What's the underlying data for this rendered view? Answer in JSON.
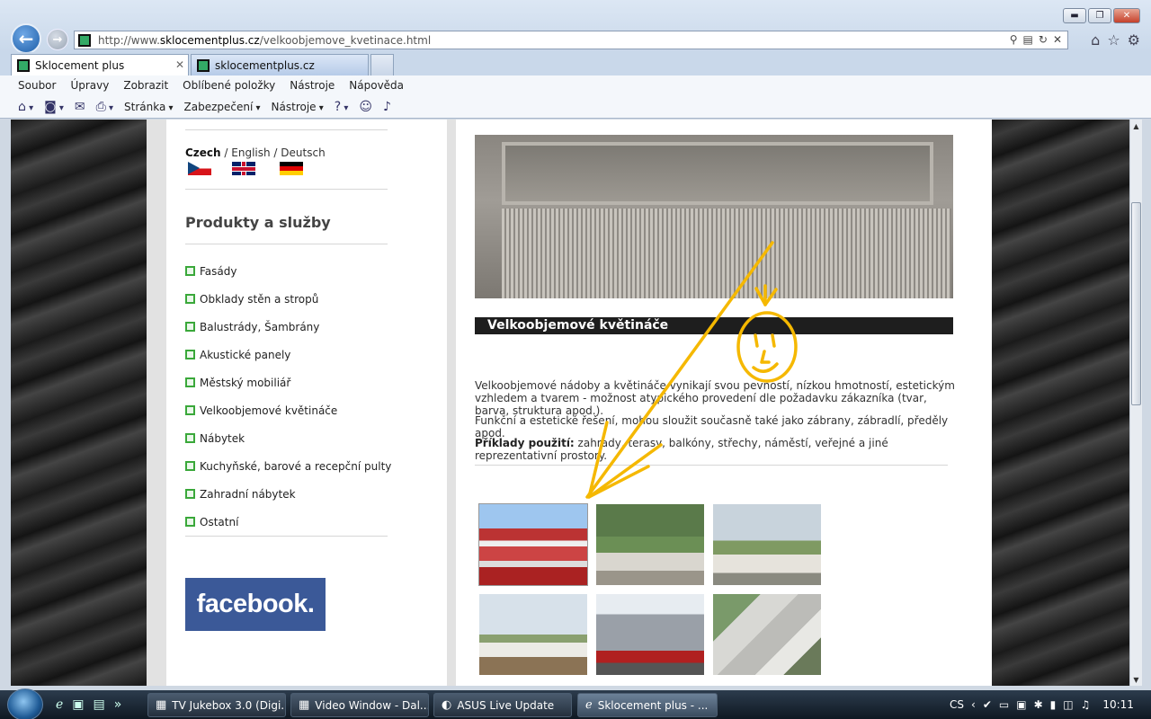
{
  "browser": {
    "url_prefix": "http://www.",
    "url_domain": "sklocementplus.cz",
    "url_path": "/velkoobjemove_kvetinace.html",
    "tabs": [
      {
        "label": "Sklocement plus",
        "close": "✕"
      },
      {
        "label": "sklocementplus.cz"
      }
    ],
    "menu": [
      "Soubor",
      "Úpravy",
      "Zobrazit",
      "Oblíbené položky",
      "Nástroje",
      "Nápověda"
    ],
    "commands": {
      "page": "Stránka",
      "security": "Zabezpečení",
      "tools": "Nástroje"
    },
    "window": {
      "minimize": "▬",
      "restore": "❐",
      "close": "✕"
    }
  },
  "sidebar": {
    "lang_czech": "Czech",
    "lang_english": "English",
    "lang_deutsch": "Deutsch",
    "sep": " / ",
    "products_title": "Produkty a služby",
    "products": [
      "Fasády",
      "Obklady stěn a stropů",
      "Balustrády, Šambrány",
      "Akustické panely",
      "Městský mobiliář",
      "Velkoobjemové květináče",
      "Nábytek",
      "Kuchyňské, barové a recepční pulty",
      "Zahradní nábytek",
      "Ostatní"
    ],
    "facebook": "facebook."
  },
  "main": {
    "section_title": "Velkoobjemové květináče",
    "p1": "Velkoobjemové nádoby a květináče vynikají svou pevností, nízkou hmotností, estetickým vzhledem a tvarem - možnost atypického provedení dle požadavku zákazníka (tvar, barva, struktura apod.).",
    "p2": "Funkční a estetické řešení, mohou sloužit současně také jako zábrany, zábradlí, předěly apod.",
    "p3_label": "Příklady použití:",
    "p3_text": " zahrady, terasy, balkóny, střechy, náměstí, veřejné a jiné reprezentativní prostory."
  },
  "taskbar": {
    "tasks": [
      "TV Jukebox 3.0 (Digi...",
      "Video Window - Dal...",
      "ASUS Live Update",
      "Sklocement plus - ..."
    ],
    "lang": "CS",
    "time": "10:11"
  },
  "colors": {
    "accent_green": "#3aa83a",
    "facebook_blue": "#3b5998",
    "annotation": "#f5b800"
  }
}
